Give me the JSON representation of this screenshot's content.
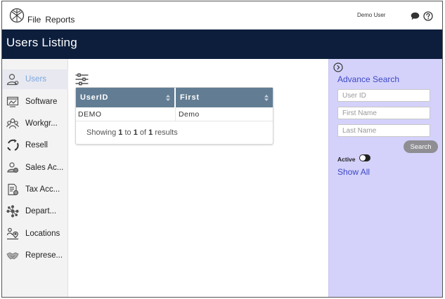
{
  "menu": {
    "file": "File",
    "reports": "Reports"
  },
  "user": {
    "name": "Demo User"
  },
  "icons": {
    "logo": "radial-logo-icon",
    "chat": "chat-bubble-icon",
    "help": "question-circle-icon",
    "filter": "sliders-icon",
    "collapse": "chevron-right-circle-icon"
  },
  "page": {
    "title": "Users Listing"
  },
  "sidebar": {
    "items": [
      {
        "label": "Users",
        "icon": "user-icon",
        "active": true
      },
      {
        "label": "Software",
        "icon": "software-icon"
      },
      {
        "label": "Workgr...",
        "icon": "group-icon"
      },
      {
        "label": "Resell",
        "icon": "resell-icon"
      },
      {
        "label": "Sales Ac...",
        "icon": "sales-account-icon"
      },
      {
        "label": "Tax Acc...",
        "icon": "tax-account-icon"
      },
      {
        "label": "Depart...",
        "icon": "department-icon"
      },
      {
        "label": "Locations",
        "icon": "location-icon"
      },
      {
        "label": "Represe...",
        "icon": "handshake-icon"
      }
    ]
  },
  "grid": {
    "columns": [
      "UserID",
      "First"
    ],
    "rows": [
      [
        "DEMO",
        "Demo"
      ]
    ],
    "footer": {
      "prefix": "Showing",
      "from": "1",
      "to_word": "to",
      "to": "1",
      "of_word": "of",
      "total": "1",
      "suffix": "results"
    }
  },
  "search": {
    "title": "Advance Search",
    "user_id_placeholder": "User ID",
    "first_name_placeholder": "First Name",
    "last_name_placeholder": "Last Name",
    "button": "Search",
    "active_label": "Active",
    "show_all": "Show All"
  },
  "colors": {
    "titlebar": "#0c1e3c",
    "grid_header": "#627d93",
    "search_panel": "#d4d2fb",
    "link": "#3d48c4",
    "active_nav": "#7aa8e0"
  }
}
